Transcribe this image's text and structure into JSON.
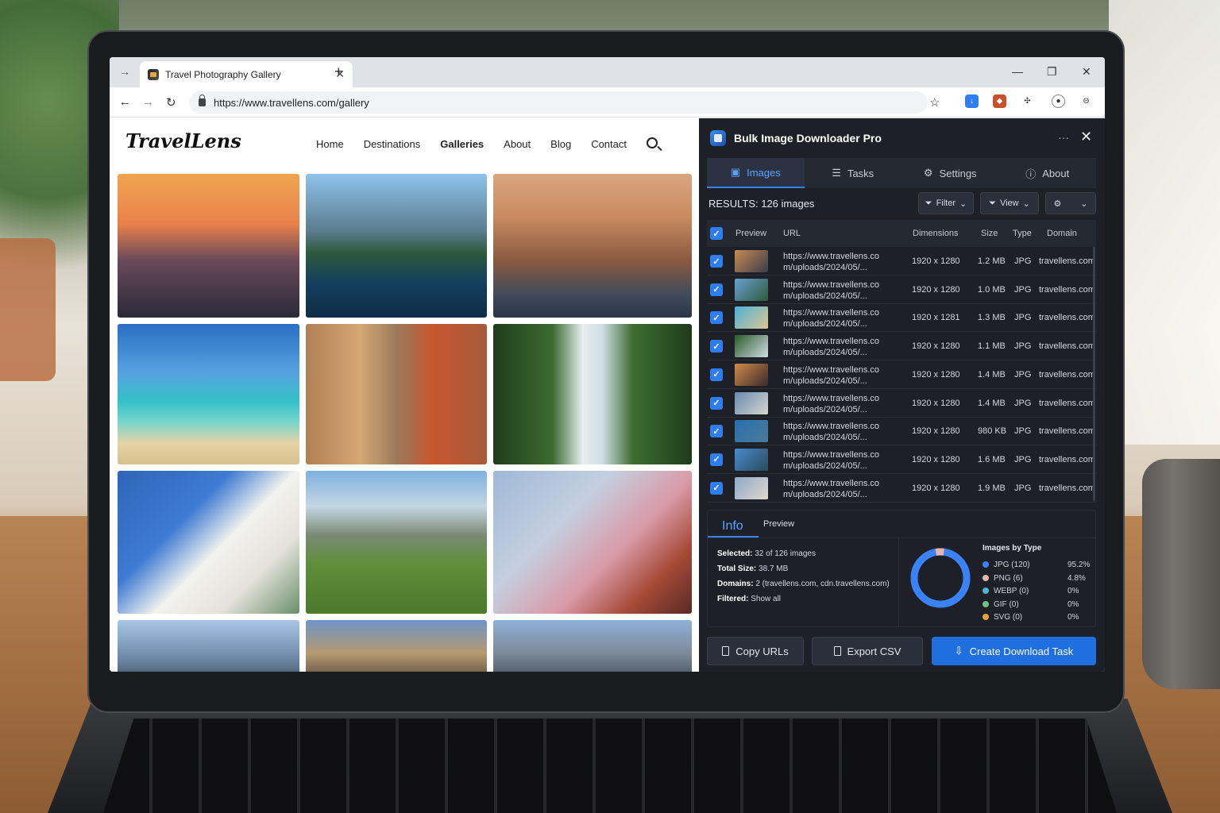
{
  "browser": {
    "tab_title": "Travel Photography Gallery",
    "url": "https://www.travellens.com/gallery"
  },
  "site": {
    "logo": "TravelLens",
    "nav": [
      "Home",
      "Destinations",
      "Galleries",
      "About",
      "Blog",
      "Contact"
    ],
    "active_nav": "Galleries"
  },
  "panel": {
    "title": "Bulk Image Downloader Pro",
    "tabs": [
      "Images",
      "Tasks",
      "Settings",
      "About"
    ],
    "results_label": "RESULTS: 126 images",
    "filter_label": "Filter",
    "view_label": "View",
    "columns": [
      "Preview",
      "URL",
      "Dimensions",
      "Size",
      "Type",
      "Domain"
    ],
    "rows": [
      {
        "url1": "https://www.travellens.co",
        "url2": "m/uploads/2024/05/...",
        "dim": "1920 x 1280",
        "size": "1.2 MB",
        "type": "JPG",
        "domain": "travellens.com"
      },
      {
        "url1": "https://www.travellens.co",
        "url2": "m/uploads/2024/05/...",
        "dim": "1920 x 1280",
        "size": "1.0 MB",
        "type": "JPG",
        "domain": "travellens.com"
      },
      {
        "url1": "https://www.travellens.co",
        "url2": "m/uploads/2024/05/...",
        "dim": "1920 x 1281",
        "size": "1.3 MB",
        "type": "JPG",
        "domain": "travellens.com"
      },
      {
        "url1": "https://www.travellens.co",
        "url2": "m/uploads/2024/05/...",
        "dim": "1920 x 1280",
        "size": "1.1 MB",
        "type": "JPG",
        "domain": "travellens.com"
      },
      {
        "url1": "https://www.travellens.co",
        "url2": "m/uploads/2024/05/...",
        "dim": "1920 x 1280",
        "size": "1.4 MB",
        "type": "JPG",
        "domain": "travellens.com"
      },
      {
        "url1": "https://www.travellens.co",
        "url2": "m/uploads/2024/05/...",
        "dim": "1920 x 1280",
        "size": "1.4 MB",
        "type": "JPG",
        "domain": "travellens.com"
      },
      {
        "url1": "https://www.travellens.co",
        "url2": "m/uploads/2024/05/...",
        "dim": "1920 x 1280",
        "size": "980 KB",
        "type": "JPG",
        "domain": "travellens.com"
      },
      {
        "url1": "https://www.travellens.co",
        "url2": "m/uploads/2024/05/...",
        "dim": "1920 x 1280",
        "size": "1.6 MB",
        "type": "JPG",
        "domain": "travellens.com"
      },
      {
        "url1": "https://www.travellens.co",
        "url2": "m/uploads/2024/05/...",
        "dim": "1920 x 1280",
        "size": "1.9 MB",
        "type": "JPG",
        "domain": "travellens.com"
      }
    ],
    "info_tabs": [
      "Info",
      "Preview"
    ],
    "info": {
      "selected_label": "Selected:",
      "selected_value": "32 of 126 images",
      "total_label": "Total Size:",
      "total_value": "38.7 MB",
      "domains_label": "Domains:",
      "domains_value": "2 (travellens.com, cdn.travellens.com)",
      "filtered_label": "Filtered:",
      "filtered_value": "Show all"
    },
    "types_title": "Images by Type",
    "types": [
      {
        "label": "JPG",
        "count": "(120)",
        "pct": "95.2%",
        "color": "#3b82f6"
      },
      {
        "label": "PNG",
        "count": "(6)",
        "pct": "4.8%",
        "color": "#e8b4b0"
      },
      {
        "label": "WEBP",
        "count": "(0)",
        "pct": "0%",
        "color": "#4fb6d8"
      },
      {
        "label": "GIF",
        "count": "(0)",
        "pct": "0%",
        "color": "#6fbf8a"
      },
      {
        "label": "SVG",
        "count": "(0)",
        "pct": "0%",
        "color": "#e9a03b"
      }
    ],
    "actions": {
      "copy": "Copy URLs",
      "export": "Export CSV",
      "create": "Create Download Task"
    }
  }
}
